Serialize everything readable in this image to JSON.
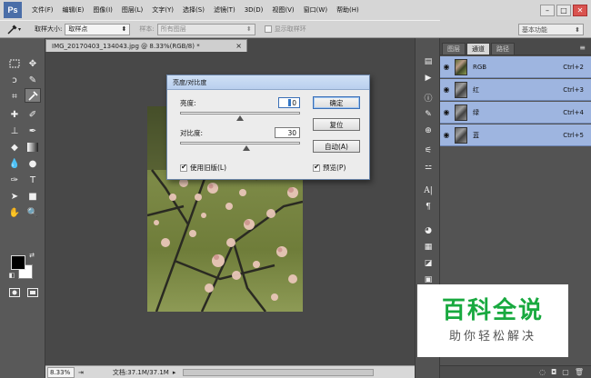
{
  "app": {
    "logo": "Ps"
  },
  "menu": [
    "文件(F)",
    "编辑(E)",
    "图像(I)",
    "图层(L)",
    "文字(Y)",
    "选择(S)",
    "滤镜(T)",
    "3D(D)",
    "视图(V)",
    "窗口(W)",
    "帮助(H)"
  ],
  "window_controls": {
    "minimize": "–",
    "restore": "□",
    "close": "✕"
  },
  "options": {
    "sample_size_label": "取样大小:",
    "sample_size_value": "取样点",
    "sample_label": "样本:",
    "sample_value": "所有图层",
    "show_ring_label": "显示取样环"
  },
  "workspace": {
    "value": "基本功能"
  },
  "document": {
    "tab_title": "IMG_20170403_134043.jpg @ 8.33%(RGB/8) *",
    "tab_close": "×",
    "zoom": "8.33%",
    "doc_info": "文档:37.1M/37.1M"
  },
  "dialog": {
    "title": "亮度/对比度",
    "brightness_label": "亮度:",
    "brightness_value": "0",
    "contrast_label": "对比度:",
    "contrast_value": "30",
    "brightness_slider": 0.5,
    "contrast_slider": 0.55,
    "ok_label": "确定",
    "reset_label": "复位",
    "auto_label": "自动(A)",
    "legacy_label": "使用旧版(L)",
    "legacy_checked": true,
    "preview_label": "预览(P)",
    "preview_checked": true
  },
  "panel": {
    "tabs": [
      "图层",
      "通道",
      "路径"
    ],
    "active_tab": 1,
    "channels": [
      {
        "name": "RGB",
        "shortcut": "Ctrl+2"
      },
      {
        "name": "红",
        "shortcut": "Ctrl+3"
      },
      {
        "name": "绿",
        "shortcut": "Ctrl+4"
      },
      {
        "name": "蓝",
        "shortcut": "Ctrl+5"
      }
    ]
  },
  "watermark": {
    "title": "百科全说",
    "subtitle": "助你轻松解决"
  },
  "colors": {
    "accent": "#18a93f",
    "selection": "#9eb5e0",
    "dialog_title": "#c4d8f2"
  }
}
